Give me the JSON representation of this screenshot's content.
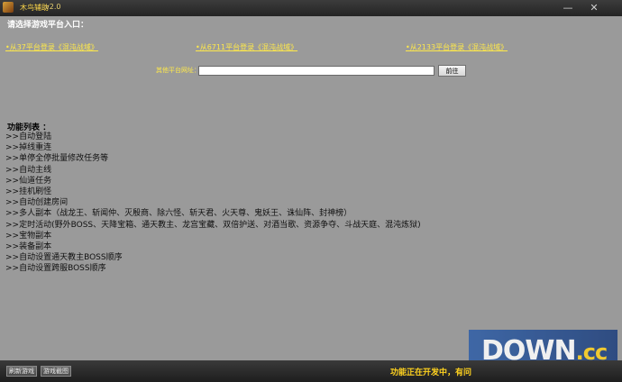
{
  "window": {
    "title": "木鸟辅助",
    "version": "v2.0",
    "minimize_glyph": "—",
    "close_glyph": "✕",
    "accent_color": "#ffe94a"
  },
  "platform": {
    "heading": "请选择游戏平台入口：",
    "links": [
      "•从37平台登录《混沌战域》",
      "•从6711平台登录《混沌战域》",
      "•从2133平台登录《混沌战域》"
    ],
    "other_label": "其他平台网址：",
    "url_value": "",
    "go_label": "前往"
  },
  "features": {
    "heading": "功能列表 ：",
    "items": [
      ">>自动登陆",
      ">>掉线重连",
      ">>单停全停批量修改任务等",
      ">>自动主线",
      ">>仙道任务",
      ">>挂机刷怪",
      ">>自动创建房间",
      ">>多人副本（战龙王、斩闻仲、灭殷商、除六怪、斩天君、火天尊、鬼妖王、诛仙阵、封神榜）",
      ">>定时活动(野外BOSS、天降宝箱、通天教主、龙宫宝藏、双倍护送、对酒当歌、资源争夺、斗战天庭、混沌炼狱)",
      ">>宝物副本",
      ">>装备副本",
      ">>自动设置通天教主BOSS顺序",
      ">>自动设置跨服BOSS顺序"
    ]
  },
  "bottom": {
    "refresh_label": "刷新游戏",
    "screenshot_label": "游戏截图",
    "status_text": "功能正在开发中，有问"
  },
  "watermark": {
    "main": "DOWN",
    "suffix": ".cc"
  }
}
